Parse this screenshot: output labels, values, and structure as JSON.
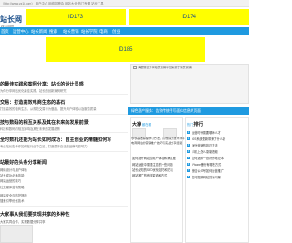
{
  "top_bar": {
    "text": "（http://www.zz1i.com）    用户中心     网络招聘会    网站大全    热门专题    站长工具"
  },
  "header": {
    "logo": "站长网",
    "logo_sub": "zz1i.com",
    "ad1": "ID173",
    "ad2": "ID174",
    "ad3": "ID185"
  },
  "nav": {
    "items": [
      "首页",
      "运营中心",
      "站长新闻",
      "搜索",
      "站长营销",
      "站长学院",
      "电商",
      "创业"
    ]
  },
  "articles": [
    {
      "title": "的最佳实践和案例分享：站长的设计灵感",
      "desc": "为你分享网站优化最佳实践，站长的创新案例研究"
    },
    {
      "title": "交易：打造高效电商生态的基石",
      "desc": "打造高效的电商生态，从规范交易行为做起，提升用户体验以及服务质量"
    },
    {
      "title": "技与数码的相互关系及其在未来的发展前景",
      "desc": "科技和数码的相互影响及其在未来的发展趋势"
    },
    {
      "title": "全时数机还能为站长如何成功：自主创业的精髓如何写",
      "desc": "专业站长告诉你如何在行业中立足，打造属于自己的品牌与影响力"
    }
  ],
  "list_section": {
    "title": "站最好的头条分享新闻",
    "items": [
      "网络设计与用户体验",
      "站长成功必备技能",
      "网站运营的技巧",
      "社交媒体营销策略",
      "网站安全与防护措施",
      "搜索引擎优化技术"
    ]
  },
  "bottom_section": {
    "title": "大家事从我们要实现共享的多种性",
    "desc": "大家共同合作，实现数据分享共享"
  },
  "featured": {
    "caption": "海量信息分享站长营销平台来源于站长营销"
  },
  "banner": {
    "text": "绿色国产服务：告别传统手写面体信息的页面"
  },
  "sidebar_hot": {
    "title": "大家",
    "title_em": "都在看",
    "items": [
      {
        "text": "零零基础编程学习方法，高效提升技术水平"
      },
      {
        "text": "电商网站的营销推广技巧与实战分享经验"
      }
    ],
    "bullets": [
      "如何提升网站的用户体验和满意度",
      "网站运营中需要注意的一些问题",
      "站长必知的SEO优化技巧和方法",
      "网站推广的有效渠道和方式"
    ]
  },
  "sidebar_rank": {
    "title": "排行",
    "title_em": "热门",
    "items": [
      "运营时代需要哪种人才",
      "iOS系统更新带来了什么新",
      "海外营销的技巧方法",
      "手机上怎么录制视频",
      "如何选购一台好的笔记本",
      "iPhone备份有哪些方式",
      "微信公众号如何运营推广",
      "如何提高网站的访问量"
    ]
  }
}
